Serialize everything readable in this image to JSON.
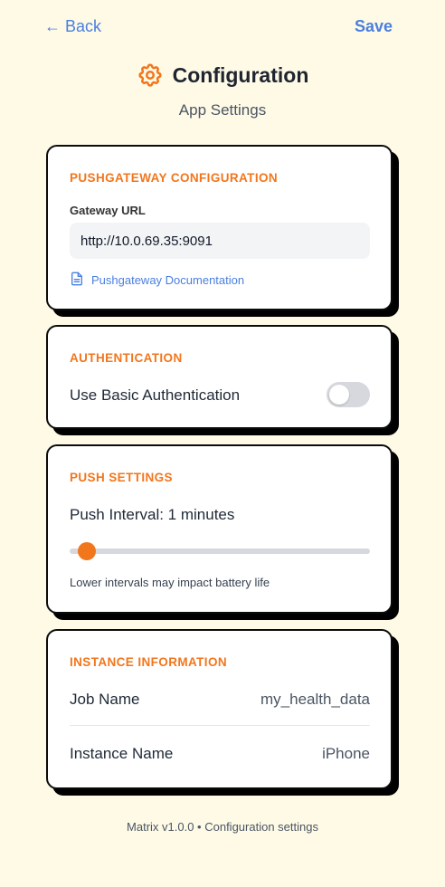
{
  "nav": {
    "back_label": "← Back",
    "save_label": "Save"
  },
  "header": {
    "icon": "gear-icon",
    "title": "Configuration",
    "subtitle": "App Settings"
  },
  "pushgateway": {
    "section_title": "PUSHGATEWAY CONFIGURATION",
    "gateway_url_label": "Gateway URL",
    "gateway_url_value": "http://10.0.69.35:9091",
    "doc_link_label": "Pushgateway Documentation",
    "doc_icon": "document-icon"
  },
  "authentication": {
    "section_title": "AUTHENTICATION",
    "basic_auth_label": "Use Basic Authentication",
    "basic_auth_enabled": false
  },
  "push_settings": {
    "section_title": "PUSH SETTINGS",
    "interval_label": "Push Interval: 1 minutes",
    "interval_value": 1,
    "slider_fraction": 0.03,
    "hint": "Lower intervals may impact battery life"
  },
  "instance": {
    "section_title": "INSTANCE INFORMATION",
    "rows": [
      {
        "key": "Job Name",
        "value": "my_health_data"
      },
      {
        "key": "Instance Name",
        "value": "iPhone"
      }
    ]
  },
  "footer": {
    "text": "Matrix v1.0.0 • Configuration settings"
  },
  "colors": {
    "background": "#fefae6",
    "accent_orange": "#f2761c",
    "link_blue": "#4a7fe0",
    "card_border": "#0b0b0b"
  }
}
